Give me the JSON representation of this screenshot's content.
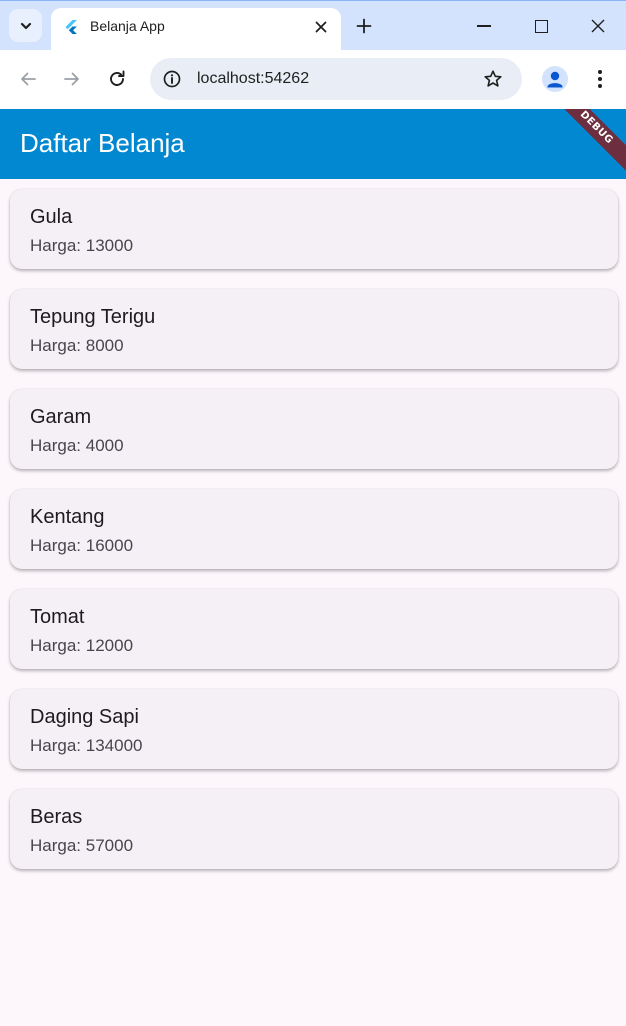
{
  "browser": {
    "tab_title": "Belanja App",
    "url": "localhost:54262"
  },
  "app": {
    "title": "Daftar Belanja",
    "debug_banner": "DEBUG",
    "colors": {
      "appbar": "#0288d1",
      "card": "#f5f0f6",
      "background": "#fdf7fc",
      "debug_banner": "#6d2f40"
    },
    "items": [
      {
        "name": "Gula",
        "price": "Harga: 13000"
      },
      {
        "name": "Tepung Terigu",
        "price": "Harga: 8000"
      },
      {
        "name": "Garam",
        "price": "Harga: 4000"
      },
      {
        "name": "Kentang",
        "price": "Harga: 16000"
      },
      {
        "name": "Tomat",
        "price": "Harga: 12000"
      },
      {
        "name": "Daging Sapi",
        "price": "Harga: 134000"
      },
      {
        "name": "Beras",
        "price": "Harga: 57000"
      }
    ]
  },
  "icons": {
    "tab_search": "chevron-down-icon",
    "favicon": "flutter-icon",
    "tab_close": "close-icon",
    "new_tab": "plus-icon",
    "back": "arrow-left-icon",
    "forward": "arrow-right-icon",
    "reload": "reload-icon",
    "site_info": "info-icon",
    "bookmark": "star-icon",
    "profile": "account-icon",
    "menu": "more-vert-icon"
  }
}
